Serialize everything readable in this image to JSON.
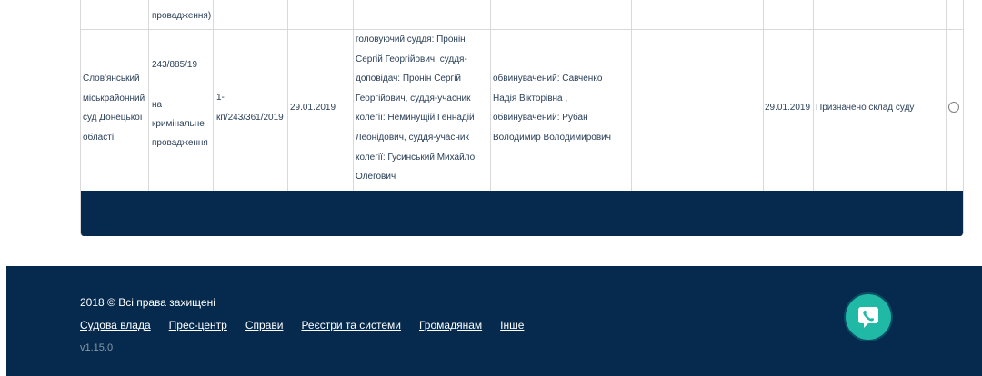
{
  "table": {
    "prev_row_fragment": "провадження)",
    "row": {
      "court": [
        "Слов'янський",
        "міськрайонний",
        "суд Донецької",
        "області"
      ],
      "case_number": "243/885/19",
      "case_type": [
        "на",
        "кримінальне",
        "провадження"
      ],
      "proceeding_number": [
        "1-",
        "кп/243/361/2019"
      ],
      "registration_date": "29.01.2019",
      "judges": [
        "головуючий суддя: Пронін",
        "Сергій Георгійович; суддя-",
        "доповідач: Пронін Сергій",
        "Георгійович, суддя-учасник",
        "колегії: Неминущій Геннадій",
        "Леонідович, суддя-учасник",
        "колегії: Гусинський Михайло",
        "Олегович"
      ],
      "parties": [
        "обвинувачений: Савченко",
        "Надія Вікторівна ,",
        "обвинувачений: Рубан",
        "Володимир Володимирович"
      ],
      "event_date": "29.01.2019",
      "status": "Призначено склад суду"
    }
  },
  "footer": {
    "copyright": "2018 © Всі права захищені",
    "links": [
      "Судова влада",
      "Прес-центр",
      "Справи",
      "Реєстри та системи",
      "Громадянам",
      "Інше"
    ],
    "version": "v1.15.0"
  },
  "colors": {
    "navy": "#062a4d",
    "teal": "#1fb9a6",
    "border": "#d9d9d9"
  }
}
